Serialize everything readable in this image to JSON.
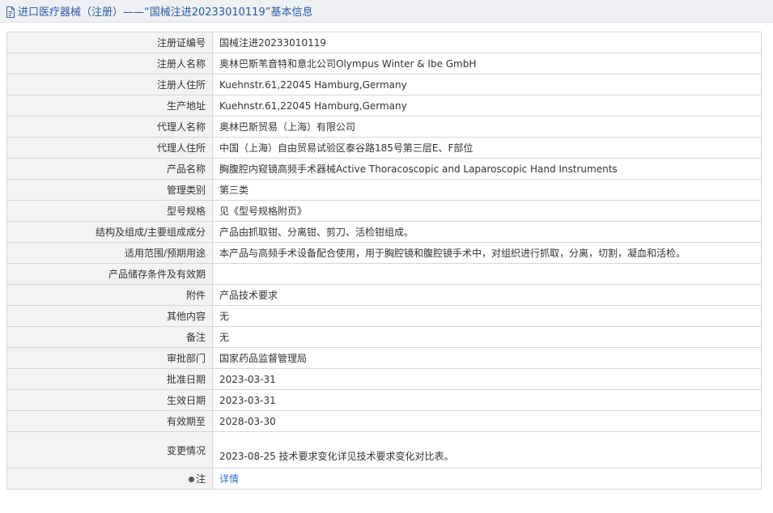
{
  "header": {
    "title": "进口医疗器械（注册）——“国械注进20233010119”基本信息"
  },
  "rows": [
    {
      "label": "注册证编号",
      "value": "国械注进20233010119"
    },
    {
      "label": "注册人名称",
      "value": "奥林巴斯苇音特和意北公司Olympus Winter & Ibe GmbH"
    },
    {
      "label": "注册人住所",
      "value": "Kuehnstr.61,22045 Hamburg,Germany"
    },
    {
      "label": "生产地址",
      "value": "Kuehnstr.61,22045 Hamburg,Germany"
    },
    {
      "label": "代理人名称",
      "value": "奥林巴斯贸易（上海）有限公司"
    },
    {
      "label": "代理人住所",
      "value": "中国（上海）自由贸易试验区泰谷路185号第三层E、F部位"
    },
    {
      "label": "产品名称",
      "value": "胸腹腔内窥镜高频手术器械Active Thoracoscopic and Laparoscopic Hand Instruments"
    },
    {
      "label": "管理类别",
      "value": "第三类"
    },
    {
      "label": "型号规格",
      "value": "见《型号规格附页》"
    },
    {
      "label": "结构及组成/主要组成成分",
      "value": "产品由抓取钳、分离钳、剪刀、活检钳组成。"
    },
    {
      "label": "适用范围/预期用途",
      "value": "本产品与高频手术设备配合使用，用于胸腔镜和腹腔镜手术中，对组织进行抓取，分离，切割，凝血和活检。"
    },
    {
      "label": "产品储存条件及有效期",
      "value": ""
    },
    {
      "label": "附件",
      "value": "产品技术要求"
    },
    {
      "label": "其他内容",
      "value": "无"
    },
    {
      "label": "备注",
      "value": "无"
    },
    {
      "label": "审批部门",
      "value": "国家药品监督管理局"
    },
    {
      "label": "批准日期",
      "value": "2023-03-31"
    },
    {
      "label": "生效日期",
      "value": "2023-03-31"
    },
    {
      "label": "有效期至",
      "value": "2028-03-30"
    },
    {
      "label": "变更情况",
      "value": "2023-08-25 技术要求变化详见技术要求变化对比表。"
    }
  ],
  "footer_row": {
    "label": "注",
    "link_text": "详情"
  }
}
